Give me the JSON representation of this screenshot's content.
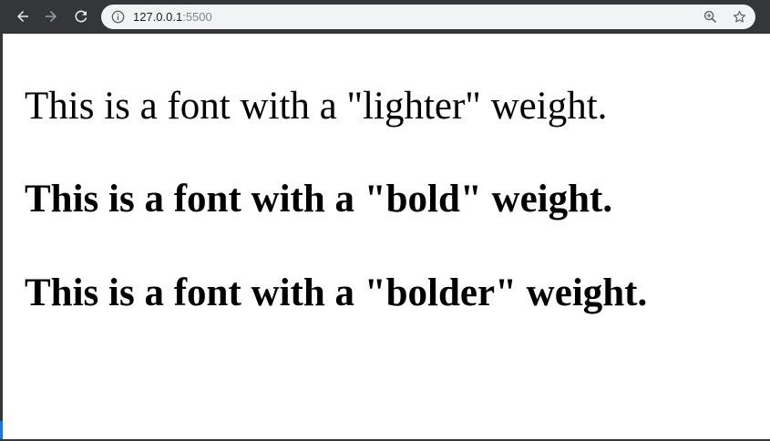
{
  "browser": {
    "url_host": "127.0.0.1",
    "url_port": ":5500",
    "icons": {
      "back": "arrow-left-icon",
      "forward": "arrow-right-icon",
      "reload": "reload-icon",
      "site_info": "info-icon",
      "zoom": "zoom-icon",
      "bookmark": "star-icon"
    },
    "colors": {
      "toolbar": "#35363a",
      "omnibox": "#f1f3f4",
      "icon_active": "#e8eaed",
      "icon_disabled": "#9aa0a6"
    }
  },
  "page": {
    "lines": [
      {
        "text": "This is a font with a \"lighter\" weight.",
        "weight": "lighter"
      },
      {
        "text": "This is a font with a \"bold\" weight.",
        "weight": "bold"
      },
      {
        "text": "This is a font with a \"bolder\" weight.",
        "weight": "bolder"
      }
    ]
  }
}
